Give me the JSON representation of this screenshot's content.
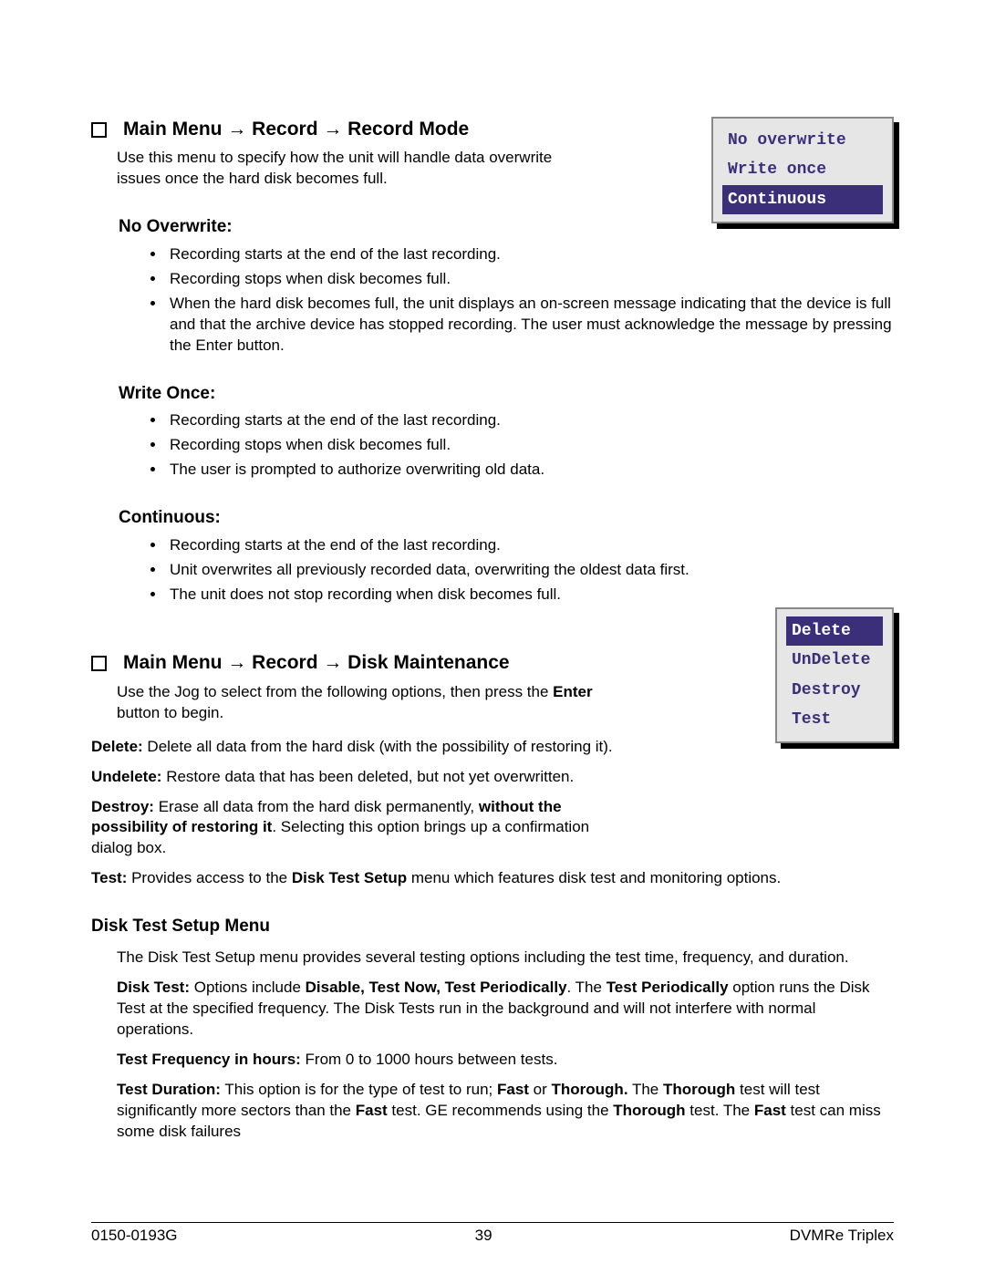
{
  "section1": {
    "heading": "Main Menu → Record → Record Mode",
    "intro": "Use this menu to specify how the unit will handle data overwrite issues once the hard disk becomes full.",
    "menu": {
      "items": [
        "No overwrite",
        "Write once",
        "Continuous"
      ],
      "selected_index": 2
    },
    "groups": [
      {
        "title": "No Overwrite:",
        "bullets": [
          "Recording starts at the end of the last recording.",
          "Recording stops when disk becomes full.",
          "When the hard disk becomes full, the unit displays an on-screen message indicating that the device is full and that the archive device has stopped recording.  The user must acknowledge the message by pressing the Enter button."
        ]
      },
      {
        "title": "Write Once:",
        "bullets": [
          "Recording starts at the end of the last recording.",
          "Recording stops when disk becomes full.",
          "The user is prompted to authorize overwriting old data."
        ]
      },
      {
        "title": "Continuous:",
        "bullets": [
          "Recording starts at the end of the last recording.",
          "Unit overwrites all previously recorded data, overwriting the oldest data first.",
          "The unit does not stop recording when disk becomes full."
        ]
      }
    ]
  },
  "section2": {
    "heading": "Main Menu → Record → Disk Maintenance",
    "intro_pre": "Use the Jog to select from the following options, then press the ",
    "intro_bold": "Enter",
    "intro_post": " button to begin.",
    "menu": {
      "items": [
        "Delete",
        "UnDelete",
        "Destroy",
        "Test"
      ],
      "selected_index": 0
    },
    "definitions": [
      {
        "term": "Delete:",
        "text": "  Delete all data from the hard disk (with the possibility of restoring it)."
      },
      {
        "term": "Undelete:",
        "text": "  Restore data that has been deleted, but not yet overwritten."
      }
    ],
    "destroy": {
      "term": "Destroy:",
      "pre": "  Erase all data from the hard disk permanently, ",
      "bold": "without the possibility of restoring it",
      "post": ". Selecting this option brings up a confirmation dialog box."
    },
    "test": {
      "term": "Test:",
      "pre": " Provides access to the ",
      "bold": "Disk Test Setup",
      "post": " menu which features disk test and monitoring options."
    },
    "dtsm": {
      "heading": "Disk Test Setup Menu",
      "intro": "The Disk Test Setup menu provides several testing options including the test time, frequency, and duration.",
      "disk_test": {
        "t1": "Disk Test:",
        "p1": " Options include ",
        "t2": "Disable, Test Now, Test Periodically",
        "p2": ". The ",
        "t3": "Test Periodically",
        "p3": " option runs the Disk Test at the specified frequency. The Disk Tests run in the background and will not interfere with normal operations."
      },
      "freq": {
        "t": "Test Frequency in hours:",
        "p": " From 0 to 1000 hours between tests."
      },
      "dur": {
        "t1": "Test Duration:",
        "p1": " This option is for the type of test to run; ",
        "t2": "Fast",
        "p2": " or ",
        "t3": "Thorough.",
        "p3": " The ",
        "t4": "Thorough",
        "p4": " test will test significantly more sectors than the ",
        "t5": "Fast",
        "p5": " test. GE recommends using the ",
        "t6": "Thorough",
        "p6": " test. The ",
        "t7": "Fast",
        "p7": " test can miss some disk failures"
      }
    }
  },
  "footer": {
    "left": "0150-0193G",
    "center": "39",
    "right": "DVMRe Triplex"
  }
}
